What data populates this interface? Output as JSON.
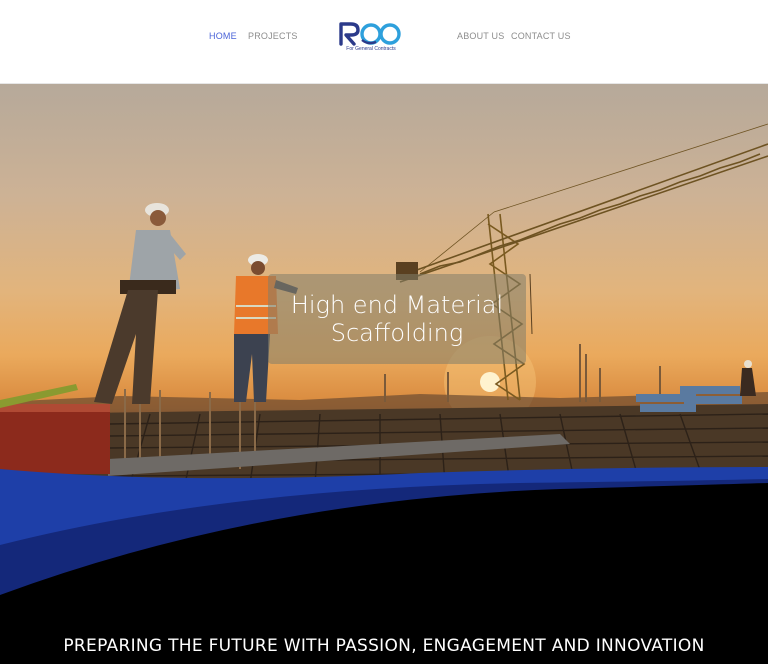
{
  "nav": {
    "left": [
      {
        "label": "HOME",
        "active": true
      },
      {
        "label": "PROJECTS",
        "active": false
      }
    ],
    "right": [
      {
        "label": "ABOUT US",
        "active": false
      },
      {
        "label": "CONTACT US",
        "active": false
      }
    ],
    "active_color": "#4a63d8",
    "inactive_color": "#8d8d8d"
  },
  "logo": {
    "wordmark": "ROO",
    "subtitle": "For General Contracts",
    "colors": [
      "#2b3a8a",
      "#2ea0dc"
    ]
  },
  "hero": {
    "caption": "High end Material\nScaffolding",
    "image": "construction-site-sunset-with-crane-and-workers"
  },
  "footer": {
    "tagline": "PREPARING THE FUTURE WITH PASSION, ENGAGEMENT AND INNOVATION",
    "wave_colors": [
      "#1e3fa8",
      "#14287a",
      "#000000"
    ]
  }
}
